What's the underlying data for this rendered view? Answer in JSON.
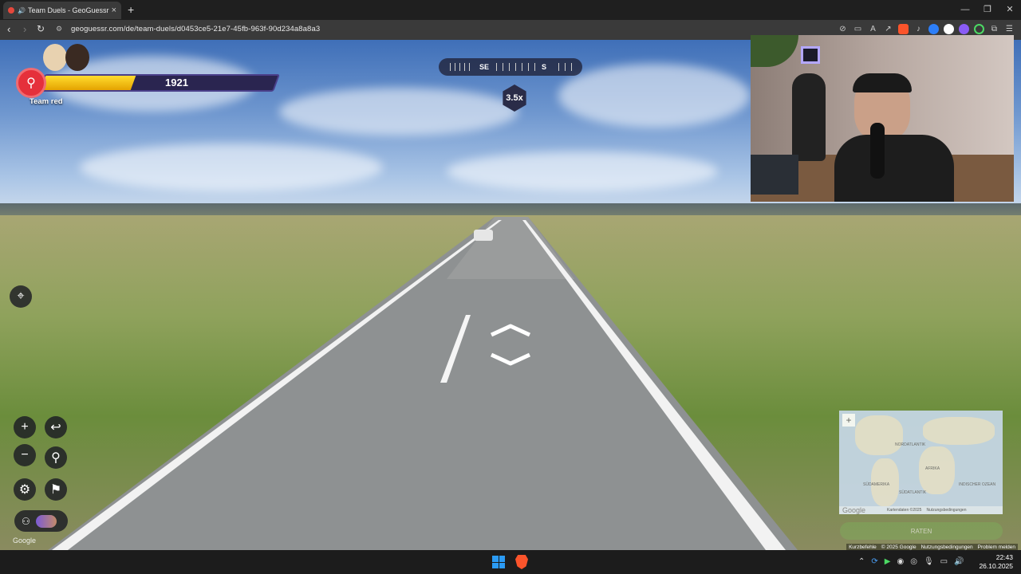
{
  "browser": {
    "tab_title": "Team Duels - GeoGuessr",
    "url": "geoguessr.com/de/team-duels/d0453ce5-21e7-45fb-963f-90d234a8a8a3",
    "new_tab": "+",
    "close_tab": "×"
  },
  "hud": {
    "score": "1921",
    "health_fraction": 0.39,
    "team_label": "Team red",
    "team_color": "#e5303b",
    "bar_color": "#f5c000"
  },
  "compass": {
    "labels": [
      "SE",
      "S"
    ]
  },
  "zoom": "3.5x",
  "minimap": {
    "plus": "+",
    "labels": [
      "AFRIKA",
      "SÜDAMERIKA",
      "NORDATLANTIK",
      "SÜDATLANTIK",
      "INDISCHER OZEAN"
    ],
    "footer": [
      "Google",
      "Kartendaten ©2025",
      "Nutzungsbedingungen"
    ]
  },
  "guess_button": "RATEN",
  "footer_links": [
    "Kurzbefehle",
    "© 2025 Google",
    "Nutzungsbedingungen",
    "Problem melden"
  ],
  "google_mark": "Google",
  "taskbar": {
    "time": "22:43",
    "date": "26.10.2025"
  }
}
